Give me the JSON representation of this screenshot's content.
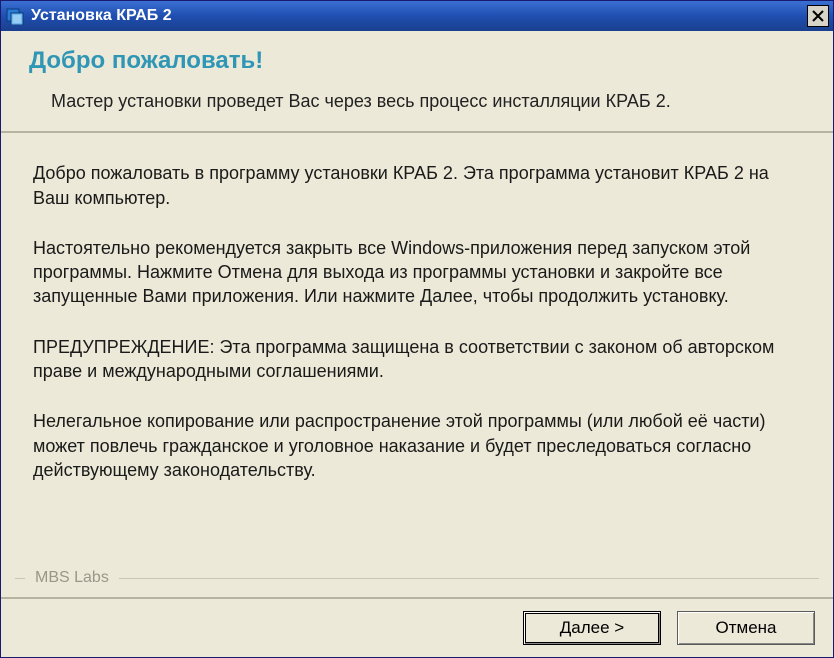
{
  "titlebar": {
    "title": "Установка КРАБ 2"
  },
  "header": {
    "heading": "Добро пожаловать!",
    "subtitle": "Мастер установки проведет Вас через весь процесс инсталляции КРАБ 2."
  },
  "body": {
    "para1": "Добро пожаловать в программу установки КРАБ 2. Эта программа установит КРАБ 2 на Ваш компьютер.",
    "para2": "Настоятельно рекомендуется закрыть все Windows-приложения перед запуском этой программы. Нажмите Отмена для выхода из программы установки и закройте все запущенные Вами приложения. Или нажмите Далее, чтобы продолжить установку.",
    "para3": "ПРЕДУПРЕЖДЕНИЕ: Эта программа защищена в соответствии с законом об авторском праве и международными соглашениями.",
    "para4": "Нелегальное копирование или распространение этой программы (или любой её части) может повлечь гражданское и уголовное наказание и будет преследоваться согласно действующему законодательству."
  },
  "vendor": "MBS Labs",
  "buttons": {
    "next": "Далее >",
    "cancel": "Отмена"
  }
}
